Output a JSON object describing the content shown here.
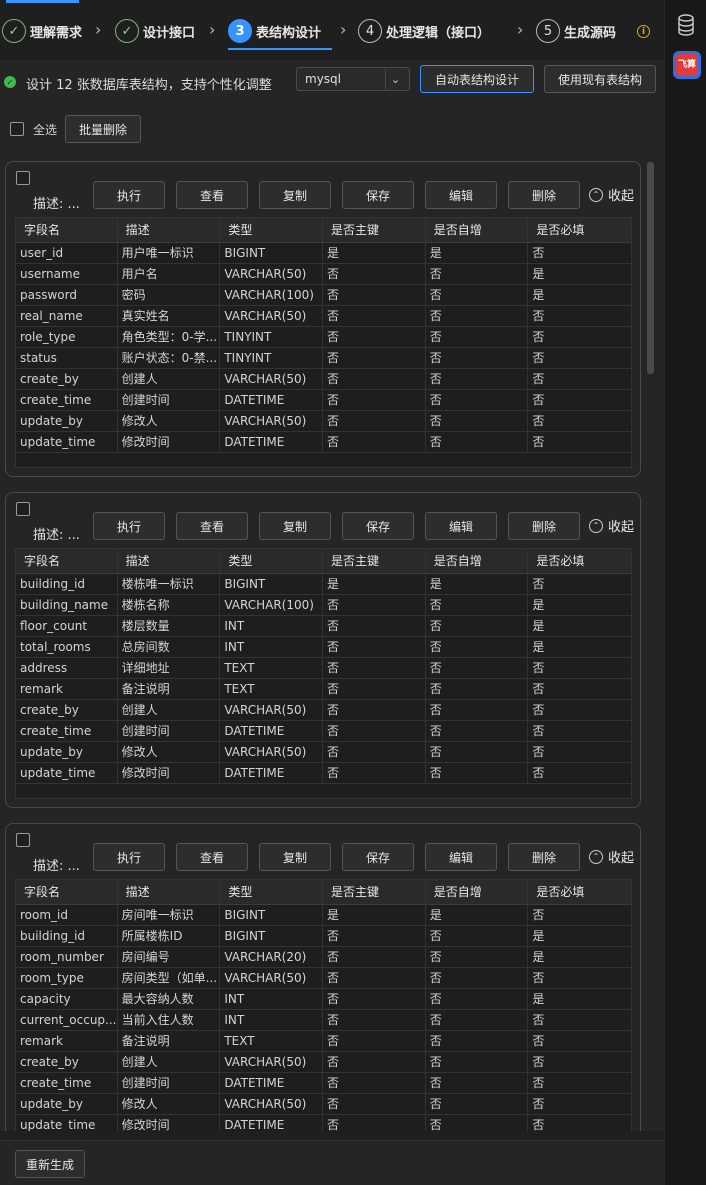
{
  "steps": [
    {
      "num": "✓",
      "label": "理解需求",
      "state": "done"
    },
    {
      "num": "✓",
      "label": "设计接口",
      "state": "done"
    },
    {
      "num": "3",
      "label": "表结构设计",
      "state": "active"
    },
    {
      "num": "4",
      "label": "处理逻辑（接口）",
      "state": "todo"
    },
    {
      "num": "5",
      "label": "生成源码",
      "state": "todo"
    }
  ],
  "infobar": {
    "text": "设计 12 张数据库表结构，支持个性化调整",
    "db_value": "mysql",
    "auto_btn": "自动表结构设计",
    "use_existing_btn": "使用现有表结构"
  },
  "toolbar": {
    "select_all": "全选",
    "batch_delete": "批量删除"
  },
  "card_actions": {
    "desc": "描述: ...",
    "execute": "执行",
    "view": "查看",
    "copy": "复制",
    "save": "保存",
    "edit": "编辑",
    "delete": "删除",
    "collapse": "收起"
  },
  "table_headers": [
    "字段名",
    "描述",
    "类型",
    "是否主键",
    "是否自增",
    "是否必填"
  ],
  "tables": [
    {
      "rows": [
        [
          "user_id",
          "用户唯一标识",
          "BIGINT",
          "是",
          "是",
          "否"
        ],
        [
          "username",
          "用户名",
          "VARCHAR(50)",
          "否",
          "否",
          "是"
        ],
        [
          "password",
          "密码",
          "VARCHAR(100)",
          "否",
          "否",
          "是"
        ],
        [
          "real_name",
          "真实姓名",
          "VARCHAR(50)",
          "否",
          "否",
          "否"
        ],
        [
          "role_type",
          "角色类型：0-学...",
          "TINYINT",
          "否",
          "否",
          "否"
        ],
        [
          "status",
          "账户状态：0-禁...",
          "TINYINT",
          "否",
          "否",
          "否"
        ],
        [
          "create_by",
          "创建人",
          "VARCHAR(50)",
          "否",
          "否",
          "否"
        ],
        [
          "create_time",
          "创建时间",
          "DATETIME",
          "否",
          "否",
          "否"
        ],
        [
          "update_by",
          "修改人",
          "VARCHAR(50)",
          "否",
          "否",
          "否"
        ],
        [
          "update_time",
          "修改时间",
          "DATETIME",
          "否",
          "否",
          "否"
        ]
      ]
    },
    {
      "rows": [
        [
          "building_id",
          "楼栋唯一标识",
          "BIGINT",
          "是",
          "是",
          "否"
        ],
        [
          "building_name",
          "楼栋名称",
          "VARCHAR(100)",
          "否",
          "否",
          "是"
        ],
        [
          "floor_count",
          "楼层数量",
          "INT",
          "否",
          "否",
          "是"
        ],
        [
          "total_rooms",
          "总房间数",
          "INT",
          "否",
          "否",
          "是"
        ],
        [
          "address",
          "详细地址",
          "TEXT",
          "否",
          "否",
          "否"
        ],
        [
          "remark",
          "备注说明",
          "TEXT",
          "否",
          "否",
          "否"
        ],
        [
          "create_by",
          "创建人",
          "VARCHAR(50)",
          "否",
          "否",
          "否"
        ],
        [
          "create_time",
          "创建时间",
          "DATETIME",
          "否",
          "否",
          "否"
        ],
        [
          "update_by",
          "修改人",
          "VARCHAR(50)",
          "否",
          "否",
          "否"
        ],
        [
          "update_time",
          "修改时间",
          "DATETIME",
          "否",
          "否",
          "否"
        ]
      ]
    },
    {
      "rows": [
        [
          "room_id",
          "房间唯一标识",
          "BIGINT",
          "是",
          "是",
          "否"
        ],
        [
          "building_id",
          "所属楼栋ID",
          "BIGINT",
          "否",
          "否",
          "是"
        ],
        [
          "room_number",
          "房间编号",
          "VARCHAR(20)",
          "否",
          "否",
          "是"
        ],
        [
          "room_type",
          "房间类型（如单...",
          "VARCHAR(50)",
          "否",
          "否",
          "否"
        ],
        [
          "capacity",
          "最大容纳人数",
          "INT",
          "否",
          "否",
          "是"
        ],
        [
          "current_occup...",
          "当前入住人数",
          "INT",
          "否",
          "否",
          "否"
        ],
        [
          "remark",
          "备注说明",
          "TEXT",
          "否",
          "否",
          "否"
        ],
        [
          "create_by",
          "创建人",
          "VARCHAR(50)",
          "否",
          "否",
          "否"
        ],
        [
          "create_time",
          "创建时间",
          "DATETIME",
          "否",
          "否",
          "否"
        ],
        [
          "update_by",
          "修改人",
          "VARCHAR(50)",
          "否",
          "否",
          "否"
        ],
        [
          "update_time",
          "修改时间",
          "DATETIME",
          "否",
          "否",
          "否"
        ]
      ]
    }
  ],
  "bottom": {
    "regenerate": "重新生成"
  },
  "rightbar": {
    "app_label": "飞算"
  },
  "colors": {
    "accent": "#3794ff",
    "success": "#3fb950",
    "warning": "#e5a530"
  }
}
